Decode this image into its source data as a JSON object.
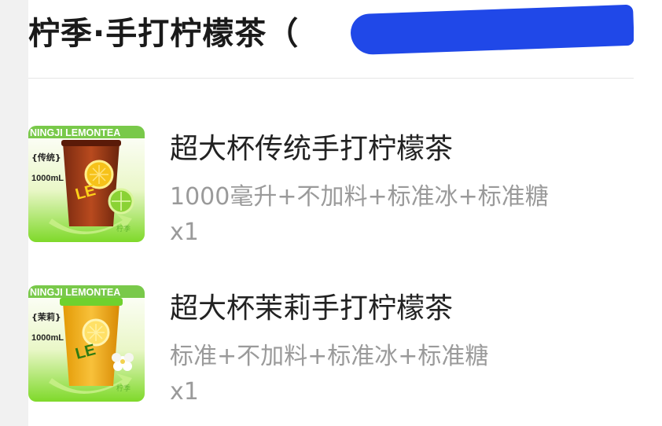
{
  "store": {
    "name": "柠季·手打柠檬茶（"
  },
  "items": [
    {
      "name": "超大杯传统手打柠檬茶",
      "spec": "1000毫升+不加料+标准冰+标准糖",
      "qty": "x1",
      "image": {
        "brand": "NINGJI LEMONTEA",
        "flavor": "{传统}",
        "volume": "1000mL",
        "drink_color": "#a0421c",
        "garnish_icon": "lime-slice"
      }
    },
    {
      "name": "超大杯茉莉手打柠檬茶",
      "spec": "标准+不加料+标准冰+标准糖",
      "qty": "x1",
      "image": {
        "brand": "NINGJI LEMONTEA",
        "flavor": "{茉莉}",
        "volume": "1000mL",
        "drink_color": "#f3b114",
        "garnish_icon": "jasmine-flower"
      }
    }
  ]
}
